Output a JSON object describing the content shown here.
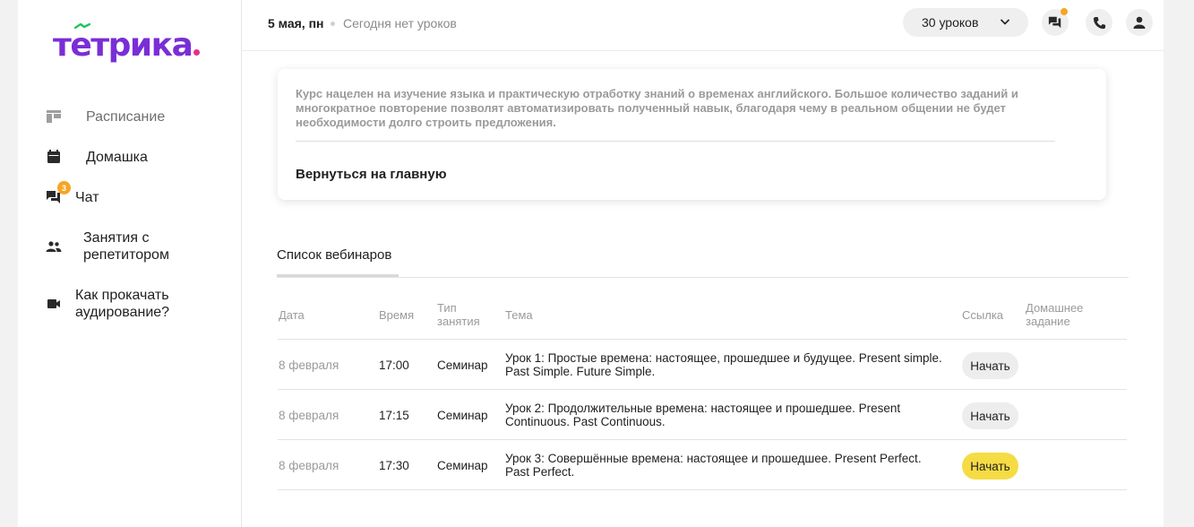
{
  "brand": {
    "logo_text": "тетрика",
    "accent_color": "#7a2ed6",
    "dot_color": "#e82d8a"
  },
  "sidebar": {
    "items": [
      {
        "label": "Расписание",
        "icon": "schedule-icon",
        "active": true
      },
      {
        "label": "Домашка",
        "icon": "calendar-icon"
      },
      {
        "label": "Чат",
        "icon": "chat-icon",
        "badge": "3"
      },
      {
        "label": "Занятия с\nрепетитором",
        "icon": "people-icon"
      },
      {
        "label": "Как прокачать\nаудирование?",
        "icon": "video-icon"
      }
    ]
  },
  "header": {
    "date": "5 мая, пн",
    "status": "Сегодня нет уроков",
    "lessons_button": "30 уроков",
    "icons": [
      "chat-icon",
      "phone-icon",
      "user-icon"
    ]
  },
  "course_card": {
    "description": "Курс нацелен на изучение языка и практическую отработку знаний о временах английского. Большое количество заданий и многократное повторение позволят автоматизировать полученный навык, благодаря чему в реальном общении не будет необходимости долго строить предложения.",
    "back_link": "Вернуться на главную"
  },
  "webinars": {
    "tab_label": "Список вебинаров",
    "columns": {
      "date": "Дата",
      "time": "Время",
      "type": "Тип\nзанятия",
      "topic": "Тема",
      "link": "Ссылка",
      "homework": "Домашнее\nзадание"
    },
    "rows": [
      {
        "date": "8 февраля",
        "time": "17:00",
        "type": "Семинар",
        "topic": "Урок 1: Простые времена: настоящее, прошедшее и будущее. Present simple. Past Simple. Future Simple.",
        "button": "Начать",
        "highlighted": false
      },
      {
        "date": "8 февраля",
        "time": "17:15",
        "type": "Семинар",
        "topic": "Урок 2: Продолжительные времена: настоящее и прошедшее. Present Continuous. Past Continuous.",
        "button": "Начать",
        "highlighted": false
      },
      {
        "date": "8 февраля",
        "time": "17:30",
        "type": "Семинар",
        "topic": "Урок 3: Совершённые времена: настоящее и прошедшее. Present Perfect. Past Perfect.",
        "button": "Начать",
        "highlighted": true
      }
    ]
  }
}
